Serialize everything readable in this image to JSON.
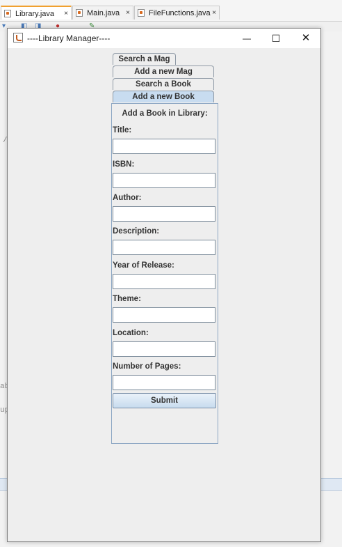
{
  "ide": {
    "tabs": [
      {
        "label": "Library.java",
        "close": "×"
      },
      {
        "label": "Main.java",
        "close": "×"
      },
      {
        "label": "FileFunctions.java",
        "close": "×"
      }
    ],
    "side_text": [
      "/",
      "ab",
      "up"
    ]
  },
  "window": {
    "title": "----Library Manager----",
    "controls": {
      "minimize": "—",
      "maximize": "☐",
      "close": "✕"
    }
  },
  "tabs": [
    {
      "label": "Search a Mag"
    },
    {
      "label": "Add a new Mag"
    },
    {
      "label": "Search a Book"
    },
    {
      "label": "Add a new Book",
      "selected": true
    }
  ],
  "form": {
    "heading": "Add a Book in Library:",
    "fields": [
      {
        "label": "Title:",
        "value": ""
      },
      {
        "label": "ISBN:",
        "value": ""
      },
      {
        "label": "Author:",
        "value": ""
      },
      {
        "label": "Description:",
        "value": ""
      },
      {
        "label": "Year of Release:",
        "value": ""
      },
      {
        "label": "Theme:",
        "value": ""
      },
      {
        "label": "Location:",
        "value": ""
      },
      {
        "label": "Number of Pages:",
        "value": ""
      }
    ],
    "submit_label": "Submit"
  },
  "colors": {
    "selected_tab": "#c8dcf0",
    "panel_border": "#8da7c4",
    "tab_accent": "#f0a030"
  }
}
